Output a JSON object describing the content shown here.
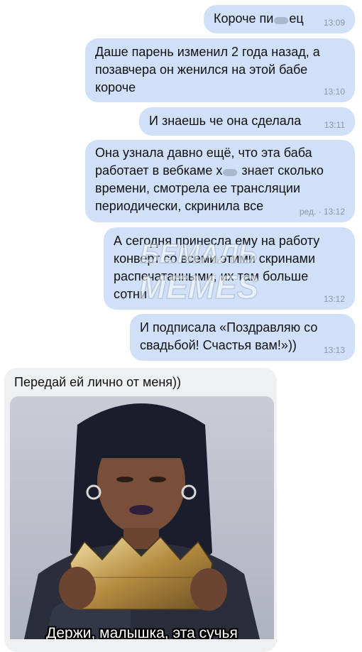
{
  "messages": [
    {
      "text": "Короче пи",
      "text_after": "ец",
      "time": "13:09"
    },
    {
      "text": "Даше парень изменил 2 года назад, а позавчера он женился на этой бабе короче",
      "time": "13:10"
    },
    {
      "text": "И знаешь че она сделала",
      "time": "13:11"
    },
    {
      "line1": "Она узнала давно ещё, что эта баба",
      "line2a": "работает в вебкаме х",
      "line2b": "знает сколько",
      "line3": "времени, смотрела ее трансляции",
      "line4": "периодически, скринила все",
      "time": "ред. · 13:12"
    },
    {
      "text": "А сегодня принесла ему на работу конверт со всеми этими скринами распечатанными, их там больше сотни",
      "time": "13:12"
    },
    {
      "text": "И подписала «Поздравляю со свадьбой! Счастья вам!»))",
      "time": "13:13"
    }
  ],
  "incoming": {
    "text": "Передай ей лично от меня))",
    "image_caption": "Держи, малышка, эта сучья"
  },
  "watermark": {
    "line1": "БЕМАЛЬ",
    "line2": "MEMES"
  },
  "colors": {
    "outgoing": "#cfe0f8",
    "incoming": "#eff0f2",
    "time": "#8b97a7"
  }
}
